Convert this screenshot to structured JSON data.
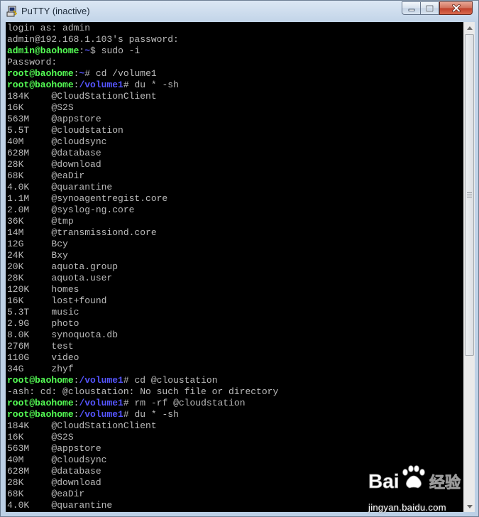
{
  "window": {
    "title": "PuTTY (inactive)",
    "icons": {
      "app": "putty-icon",
      "minimize": "minimize-icon",
      "maximize": "maximize-icon",
      "close": "close-icon"
    }
  },
  "scrollbar": {
    "position_fraction": 0.0,
    "visible_fraction": 0.69
  },
  "terminal": {
    "colors": {
      "text": "#bbbbbb",
      "prompt_user": "#55ff55",
      "prompt_path": "#5555ff",
      "background": "#000000"
    },
    "lines": [
      {
        "text": "login as: admin"
      },
      {
        "text": "admin@192.168.1.103's password:"
      },
      {
        "prompt": {
          "user": "admin@baohome",
          "sep": ":",
          "path": "~",
          "sym": "$"
        },
        "text": " sudo -i"
      },
      {
        "text": "Password:"
      },
      {
        "prompt": {
          "user": "root@baohome",
          "sep": ":",
          "path": "~",
          "sym": "#"
        },
        "text": " cd /volume1"
      },
      {
        "prompt": {
          "user": "root@baohome",
          "sep": ":",
          "path": "/volume1",
          "sym": "#"
        },
        "text": " du * -sh"
      },
      {
        "text": "184K    @CloudStationClient"
      },
      {
        "text": "16K     @S2S"
      },
      {
        "text": "563M    @appstore"
      },
      {
        "text": "5.5T    @cloudstation"
      },
      {
        "text": "40M     @cloudsync"
      },
      {
        "text": "628M    @database"
      },
      {
        "text": "28K     @download"
      },
      {
        "text": "68K     @eaDir"
      },
      {
        "text": "4.0K    @quarantine"
      },
      {
        "text": "1.1M    @synoagentregist.core"
      },
      {
        "text": "2.0M    @syslog-ng.core"
      },
      {
        "text": "36K     @tmp"
      },
      {
        "text": "14M     @transmissiond.core"
      },
      {
        "text": "12G     Bcy"
      },
      {
        "text": "24K     Bxy"
      },
      {
        "text": "20K     aquota.group"
      },
      {
        "text": "28K     aquota.user"
      },
      {
        "text": "120K    homes"
      },
      {
        "text": "16K     lost+found"
      },
      {
        "text": "5.3T    music"
      },
      {
        "text": "2.9G    photo"
      },
      {
        "text": "8.0K    synoquota.db"
      },
      {
        "text": "276M    test"
      },
      {
        "text": "110G    video"
      },
      {
        "text": "34G     zhyf"
      },
      {
        "prompt": {
          "user": "root@baohome",
          "sep": ":",
          "path": "/volume1",
          "sym": "#"
        },
        "text": " cd @cloustation"
      },
      {
        "text": "-ash: cd: @cloustation: No such file or directory"
      },
      {
        "prompt": {
          "user": "root@baohome",
          "sep": ":",
          "path": "/volume1",
          "sym": "#"
        },
        "text": " rm -rf @cloudstation"
      },
      {
        "prompt": {
          "user": "root@baohome",
          "sep": ":",
          "path": "/volume1",
          "sym": "#"
        },
        "text": " du * -sh"
      },
      {
        "text": "184K    @CloudStationClient"
      },
      {
        "text": "16K     @S2S"
      },
      {
        "text": "563M    @appstore"
      },
      {
        "text": "40M     @cloudsync"
      },
      {
        "text": "628M    @database"
      },
      {
        "text": "28K     @download"
      },
      {
        "text": "68K     @eaDir"
      },
      {
        "text": "4.0K    @quarantine"
      }
    ]
  },
  "watermark": {
    "brand": "Baidu经验",
    "url": "jingyan.baidu.com"
  }
}
